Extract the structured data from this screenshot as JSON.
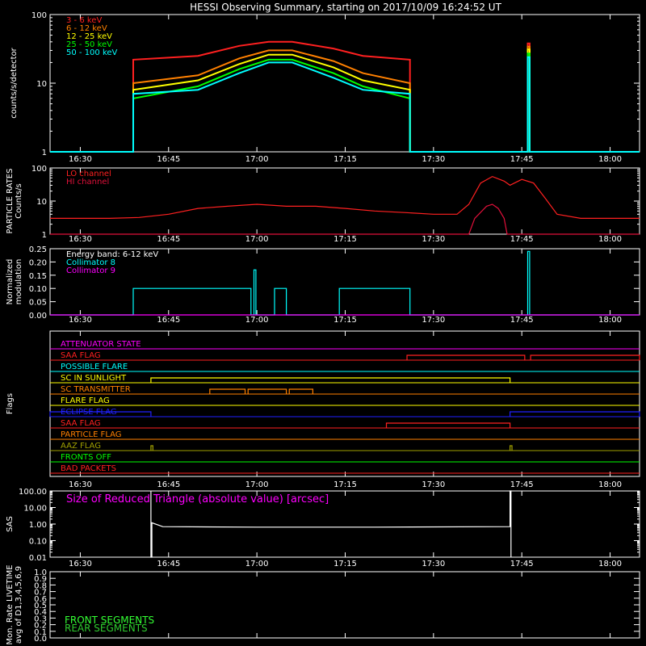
{
  "title": "HESSI Observing Summary, starting on 2017/10/09 16:24:52 UT",
  "x_ticks": [
    "16:30",
    "16:45",
    "17:00",
    "17:15",
    "17:30",
    "17:45",
    "18:00"
  ],
  "colors": {
    "red": "#ff2020",
    "orange": "#ff8000",
    "yellow": "#ffff00",
    "green": "#00ff00",
    "cyan": "#00ffff",
    "magenta": "#ff00ff",
    "blue": "#2020ff",
    "olive": "#a0a000",
    "white": "#ffffff",
    "darkred": "#e0103a"
  },
  "chart_data": [
    {
      "type": "line",
      "name": "count-rates",
      "ylabel": "counts/s/detector",
      "yscale": "log",
      "ylim": [
        1,
        100
      ],
      "y_ticks": [
        "1",
        "10",
        "100"
      ],
      "x_unit": "UT",
      "legend": [
        "3 - 6 keV",
        "6 - 12 keV",
        "12 - 25 keV",
        "25 - 50 keV",
        "50 - 100 keV"
      ],
      "legend_colors": [
        "red",
        "orange",
        "yellow",
        "green",
        "cyan"
      ],
      "series": [
        {
          "name": "3 - 6 keV",
          "color": "red",
          "points": [
            [
              "16:24:52",
              1
            ],
            [
              "16:39:00",
              1
            ],
            [
              "16:39:00",
              22
            ],
            [
              "16:50:00",
              25
            ],
            [
              "16:57:00",
              35
            ],
            [
              "17:02:00",
              40
            ],
            [
              "17:06:00",
              40
            ],
            [
              "17:13:00",
              32
            ],
            [
              "17:18:00",
              25
            ],
            [
              "17:26:00",
              22
            ],
            [
              "17:26:00",
              1
            ],
            [
              "17:46:00",
              1
            ],
            [
              "17:46:00",
              38
            ],
            [
              "17:46:20",
              38
            ],
            [
              "17:46:20",
              1
            ],
            [
              "18:05:00",
              1
            ]
          ]
        },
        {
          "name": "6 - 12 keV",
          "color": "orange",
          "points": [
            [
              "16:24:52",
              1
            ],
            [
              "16:39:00",
              1
            ],
            [
              "16:39:00",
              10
            ],
            [
              "16:50:00",
              13
            ],
            [
              "16:57:00",
              23
            ],
            [
              "17:02:00",
              30
            ],
            [
              "17:06:00",
              30
            ],
            [
              "17:13:00",
              21
            ],
            [
              "17:18:00",
              14
            ],
            [
              "17:26:00",
              10
            ],
            [
              "17:26:00",
              1
            ],
            [
              "17:46:00",
              1
            ],
            [
              "17:46:00",
              34
            ],
            [
              "17:46:20",
              34
            ],
            [
              "17:46:20",
              1
            ],
            [
              "18:05:00",
              1
            ]
          ]
        },
        {
          "name": "12 - 25 keV",
          "color": "yellow",
          "points": [
            [
              "16:24:52",
              1
            ],
            [
              "16:39:00",
              1
            ],
            [
              "16:39:00",
              8
            ],
            [
              "16:50:00",
              11
            ],
            [
              "16:57:00",
              19
            ],
            [
              "17:02:00",
              26
            ],
            [
              "17:06:00",
              26
            ],
            [
              "17:13:00",
              17
            ],
            [
              "17:18:00",
              11
            ],
            [
              "17:26:00",
              8
            ],
            [
              "17:26:00",
              1
            ],
            [
              "17:46:00",
              1
            ],
            [
              "17:46:00",
              31
            ],
            [
              "17:46:20",
              31
            ],
            [
              "17:46:20",
              1
            ],
            [
              "18:05:00",
              1
            ]
          ]
        },
        {
          "name": "25 - 50 keV",
          "color": "green",
          "points": [
            [
              "16:24:52",
              1
            ],
            [
              "16:39:00",
              1
            ],
            [
              "16:39:00",
              6
            ],
            [
              "16:50:00",
              9
            ],
            [
              "16:57:00",
              16
            ],
            [
              "17:02:00",
              22
            ],
            [
              "17:06:00",
              22
            ],
            [
              "17:13:00",
              14
            ],
            [
              "17:18:00",
              9
            ],
            [
              "17:26:00",
              6
            ],
            [
              "17:26:00",
              1
            ],
            [
              "17:46:00",
              1
            ],
            [
              "17:46:00",
              27
            ],
            [
              "17:46:20",
              27
            ],
            [
              "17:46:20",
              1
            ],
            [
              "18:05:00",
              1
            ]
          ]
        },
        {
          "name": "50 - 100 keV",
          "color": "cyan",
          "points": [
            [
              "16:24:52",
              1
            ],
            [
              "16:39:00",
              1
            ],
            [
              "16:39:00",
              7
            ],
            [
              "16:50:00",
              8
            ],
            [
              "16:57:00",
              14
            ],
            [
              "17:02:00",
              20
            ],
            [
              "17:06:00",
              20
            ],
            [
              "17:13:00",
              12
            ],
            [
              "17:18:00",
              8
            ],
            [
              "17:26:00",
              7
            ],
            [
              "17:26:00",
              1
            ],
            [
              "17:46:00",
              1
            ],
            [
              "17:46:00",
              24
            ],
            [
              "17:46:20",
              24
            ],
            [
              "17:46:20",
              1
            ],
            [
              "18:05:00",
              1
            ]
          ]
        }
      ]
    },
    {
      "type": "line",
      "name": "particle-rates",
      "ylabel": "PARTICLE RATES\nCounts/s",
      "yscale": "log",
      "ylim": [
        1,
        100
      ],
      "y_ticks": [
        "1",
        "10",
        "100"
      ],
      "legend": [
        "LO channel",
        "HI channel"
      ],
      "legend_colors": [
        "red",
        "darkred"
      ],
      "series": [
        {
          "name": "LO channel",
          "color": "red",
          "points": [
            [
              "16:24:52",
              3
            ],
            [
              "16:30:00",
              3
            ],
            [
              "16:35:00",
              3
            ],
            [
              "16:40:00",
              3.2
            ],
            [
              "16:45:00",
              4
            ],
            [
              "16:50:00",
              6
            ],
            [
              "16:55:00",
              7
            ],
            [
              "17:00:00",
              8
            ],
            [
              "17:05:00",
              7
            ],
            [
              "17:10:00",
              7
            ],
            [
              "17:15:00",
              6
            ],
            [
              "17:20:00",
              5
            ],
            [
              "17:25:00",
              4.5
            ],
            [
              "17:30:00",
              4
            ],
            [
              "17:34:00",
              4
            ],
            [
              "17:36:00",
              8
            ],
            [
              "17:38:00",
              35
            ],
            [
              "17:40:00",
              55
            ],
            [
              "17:42:00",
              40
            ],
            [
              "17:43:00",
              30
            ],
            [
              "17:45:00",
              45
            ],
            [
              "17:47:00",
              35
            ],
            [
              "17:49:00",
              12
            ],
            [
              "17:51:00",
              4
            ],
            [
              "17:55:00",
              3
            ],
            [
              "18:00:00",
              3
            ],
            [
              "18:05:00",
              3
            ]
          ]
        },
        {
          "name": "HI channel",
          "color": "darkred",
          "points": [
            [
              "16:24:52",
              1
            ],
            [
              "17:36:00",
              1
            ],
            [
              "17:37:00",
              3
            ],
            [
              "17:39:00",
              7
            ],
            [
              "17:40:00",
              8
            ],
            [
              "17:41:00",
              6
            ],
            [
              "17:42:00",
              3
            ],
            [
              "17:42:30",
              1
            ],
            [
              "18:05:00",
              1
            ]
          ]
        }
      ]
    },
    {
      "type": "line",
      "name": "modulation",
      "ylabel": "Normalized\nmodulation",
      "ylim": [
        0,
        0.25
      ],
      "y_ticks": [
        "0.00",
        "0.05",
        "0.10",
        "0.15",
        "0.20",
        "0.25"
      ],
      "legend": [
        "Energy band: 6-12 keV",
        "Collimator 8",
        "Collimator 9"
      ],
      "legend_colors": [
        "white",
        "cyan",
        "magenta"
      ],
      "series": [
        {
          "name": "Collimator 8",
          "color": "cyan",
          "points": [
            [
              "16:24:52",
              0
            ],
            [
              "16:39:00",
              0
            ],
            [
              "16:39:00",
              0.1
            ],
            [
              "16:59:00",
              0.1
            ],
            [
              "16:59:00",
              0
            ],
            [
              "16:59:30",
              0
            ],
            [
              "16:59:30",
              0.17
            ],
            [
              "16:59:50",
              0.17
            ],
            [
              "16:59:50",
              0
            ],
            [
              "17:03:00",
              0
            ],
            [
              "17:03:00",
              0.1
            ],
            [
              "17:05:00",
              0.1
            ],
            [
              "17:05:00",
              0
            ],
            [
              "17:14:00",
              0
            ],
            [
              "17:14:00",
              0.1
            ],
            [
              "17:26:00",
              0.1
            ],
            [
              "17:26:00",
              0
            ],
            [
              "17:46:00",
              0
            ],
            [
              "17:46:00",
              0.24
            ],
            [
              "17:46:20",
              0.24
            ],
            [
              "17:46:20",
              0
            ],
            [
              "18:05:00",
              0
            ]
          ]
        },
        {
          "name": "Collimator 9",
          "color": "magenta",
          "points": [
            [
              "16:24:52",
              0
            ],
            [
              "18:05:00",
              0
            ]
          ]
        }
      ]
    },
    {
      "type": "line",
      "name": "flags",
      "ylabel": "Flags",
      "flags": [
        {
          "label": "ATTENUATOR STATE",
          "color": "magenta",
          "segments": []
        },
        {
          "label": "SAA FLAG",
          "color": "red",
          "segments": [
            [
              "17:25:30",
              "17:45:30"
            ],
            [
              "17:46:30",
              "18:05:00"
            ]
          ]
        },
        {
          "label": "POSSIBLE FLARE",
          "color": "cyan",
          "segments": []
        },
        {
          "label": "SC IN SUNLIGHT",
          "color": "yellow",
          "segments": [
            [
              "16:42:00",
              "17:43:00"
            ]
          ]
        },
        {
          "label": "SC TRANSMITTER",
          "color": "orange",
          "segments": [
            [
              "16:52:00",
              "16:58:00"
            ],
            [
              "16:58:30",
              "17:05:00"
            ],
            [
              "17:05:30",
              "17:09:30"
            ]
          ]
        },
        {
          "label": "FLARE FLAG",
          "color": "yellow",
          "segments": []
        },
        {
          "label": "ECLIPSE FLAG",
          "color": "blue",
          "segments": [
            [
              "16:24:52",
              "16:42:00"
            ],
            [
              "17:43:00",
              "18:05:00"
            ]
          ]
        },
        {
          "label": "SAA FLAG",
          "color": "red",
          "segments": [
            [
              "17:22:00",
              "17:43:00"
            ]
          ]
        },
        {
          "label": "PARTICLE FLAG",
          "color": "orange",
          "segments": []
        },
        {
          "label": "AAZ FLAG",
          "color": "olive",
          "segments": [
            [
              "16:42:00",
              "16:42:20"
            ],
            [
              "17:43:00",
              "17:43:20"
            ]
          ]
        },
        {
          "label": "FRONTS OFF",
          "color": "green",
          "segments": []
        },
        {
          "label": "BAD PACKETS",
          "color": "red",
          "segments": []
        }
      ]
    },
    {
      "type": "line",
      "name": "sas",
      "ylabel": "SAS",
      "yscale": "log",
      "ylim": [
        0.01,
        100
      ],
      "y_ticks": [
        "0.01",
        "0.10",
        "1.00",
        "10.00",
        "100.00"
      ],
      "annotation": "Size of Reduced Triangle (absolute value) [arcsec]",
      "series": [
        {
          "color": "white",
          "points": [
            [
              "16:42:00",
              100
            ],
            [
              "16:42:00",
              0.01
            ],
            [
              "16:42:10",
              0.01
            ],
            [
              "16:42:10",
              1.2
            ],
            [
              "16:44:00",
              0.7
            ],
            [
              "17:00:00",
              0.65
            ],
            [
              "17:20:00",
              0.65
            ],
            [
              "17:43:00",
              0.7
            ],
            [
              "17:43:00",
              100
            ],
            [
              "17:43:10",
              100
            ],
            [
              "17:43:10",
              0.01
            ]
          ]
        }
      ]
    },
    {
      "type": "line",
      "name": "livetime",
      "ylabel": "Mon. Rate LIVETIME\navg of D1,3,4,5,6,9",
      "ylim": [
        0,
        1.0
      ],
      "y_ticks": [
        "0.0",
        "0.1",
        "0.2",
        "0.3",
        "0.4",
        "0.5",
        "0.6",
        "0.7",
        "0.8",
        "0.9",
        "1.0"
      ],
      "legend": [
        "FRONT SEGMENTS",
        "REAR SEGMENTS"
      ],
      "legend_colors": [
        "#33ff33",
        "#2ecc2e"
      ],
      "series": []
    }
  ]
}
